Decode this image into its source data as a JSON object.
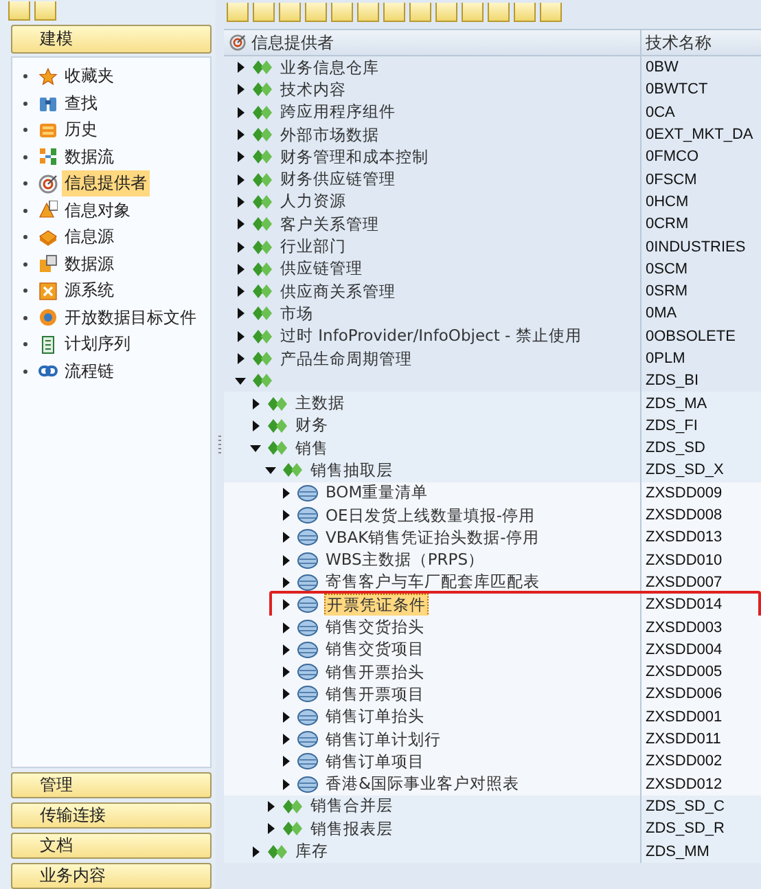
{
  "sidebar": {
    "header": "建模",
    "items": [
      {
        "label": "收藏夹",
        "selected": false
      },
      {
        "label": "查找",
        "selected": false
      },
      {
        "label": "历史",
        "selected": false
      },
      {
        "label": "数据流",
        "selected": false
      },
      {
        "label": "信息提供者",
        "selected": true
      },
      {
        "label": "信息对象",
        "selected": false
      },
      {
        "label": "信息源",
        "selected": false
      },
      {
        "label": "数据源",
        "selected": false
      },
      {
        "label": "源系统",
        "selected": false
      },
      {
        "label": "开放数据目标文件",
        "selected": false
      },
      {
        "label": "计划序列",
        "selected": false
      },
      {
        "label": "流程链",
        "selected": false
      }
    ],
    "sections": [
      "管理",
      "传输连接",
      "文档",
      "业务内容"
    ]
  },
  "tree": {
    "columns": [
      "信息提供者",
      "技术名称"
    ],
    "nodes": [
      {
        "kind": "area",
        "label": "业务信息仓库",
        "tech": "0BW",
        "expanded": false,
        "selected": false
      },
      {
        "kind": "area",
        "label": "技术内容",
        "tech": "0BWTCT",
        "expanded": false,
        "selected": false
      },
      {
        "kind": "area",
        "label": "跨应用程序组件",
        "tech": "0CA",
        "expanded": false,
        "selected": false
      },
      {
        "kind": "area",
        "label": "外部市场数据",
        "tech": "0EXT_MKT_DA",
        "expanded": false,
        "selected": false
      },
      {
        "kind": "area",
        "label": "财务管理和成本控制",
        "tech": "0FMCO",
        "expanded": false,
        "selected": false
      },
      {
        "kind": "area",
        "label": "财务供应链管理",
        "tech": "0FSCM",
        "expanded": false,
        "selected": false
      },
      {
        "kind": "area",
        "label": "人力资源",
        "tech": "0HCM",
        "expanded": false,
        "selected": false
      },
      {
        "kind": "area",
        "label": "客户关系管理",
        "tech": "0CRM",
        "expanded": false,
        "selected": false
      },
      {
        "kind": "area",
        "label": "行业部门",
        "tech": "0INDUSTRIES",
        "expanded": false,
        "selected": false
      },
      {
        "kind": "area",
        "label": "供应链管理",
        "tech": "0SCM",
        "expanded": false,
        "selected": false
      },
      {
        "kind": "area",
        "label": "供应商关系管理",
        "tech": "0SRM",
        "expanded": false,
        "selected": false
      },
      {
        "kind": "area",
        "label": "市场",
        "tech": "0MA",
        "expanded": false,
        "selected": false
      },
      {
        "kind": "area",
        "label": "过时 InfoProvider/InfoObject - 禁止使用",
        "tech": "0OBSOLETE",
        "expanded": false,
        "selected": false
      },
      {
        "kind": "area",
        "label": "产品生命周期管理",
        "tech": "0PLM",
        "expanded": false,
        "selected": false
      },
      {
        "kind": "area",
        "tech": "ZDS_BI",
        "expanded": true,
        "selected": false,
        "children": [
          {
            "kind": "area",
            "label": "主数据",
            "tech": "ZDS_MA",
            "expanded": false,
            "selected": false
          },
          {
            "kind": "area",
            "label": "财务",
            "tech": "ZDS_FI",
            "expanded": false,
            "selected": false
          },
          {
            "kind": "area",
            "label": "销售",
            "tech": "ZDS_SD",
            "expanded": true,
            "selected": false,
            "children": [
              {
                "kind": "area",
                "label": "销售抽取层",
                "tech": "ZDS_SD_X",
                "expanded": true,
                "selected": false,
                "children": [
                  {
                    "kind": "cube",
                    "label": "BOM重量清单",
                    "tech": "ZXSDD009",
                    "expanded": false,
                    "selected": false
                  },
                  {
                    "kind": "cube",
                    "label": "OE日发货上线数量填报-停用",
                    "tech": "ZXSDD008",
                    "expanded": false,
                    "selected": false
                  },
                  {
                    "kind": "cube",
                    "label": "VBAK销售凭证抬头数据-停用",
                    "tech": "ZXSDD013",
                    "expanded": false,
                    "selected": false
                  },
                  {
                    "kind": "cube",
                    "label": "WBS主数据（PRPS）",
                    "tech": "ZXSDD010",
                    "expanded": false,
                    "selected": false
                  },
                  {
                    "kind": "cube",
                    "label": "寄售客户与车厂配套库匹配表",
                    "tech": "ZXSDD007",
                    "expanded": false,
                    "selected": false
                  },
                  {
                    "kind": "cube",
                    "label": "开票凭证条件",
                    "tech": "ZXSDD014",
                    "expanded": false,
                    "selected": true
                  },
                  {
                    "kind": "cube",
                    "label": "销售交货抬头",
                    "tech": "ZXSDD003",
                    "expanded": false,
                    "selected": false
                  },
                  {
                    "kind": "cube",
                    "label": "销售交货项目",
                    "tech": "ZXSDD004",
                    "expanded": false,
                    "selected": false
                  },
                  {
                    "kind": "cube",
                    "label": "销售开票抬头",
                    "tech": "ZXSDD005",
                    "expanded": false,
                    "selected": false
                  },
                  {
                    "kind": "cube",
                    "label": "销售开票项目",
                    "tech": "ZXSDD006",
                    "expanded": false,
                    "selected": false
                  },
                  {
                    "kind": "cube",
                    "label": "销售订单抬头",
                    "tech": "ZXSDD001",
                    "expanded": false,
                    "selected": false
                  },
                  {
                    "kind": "cube",
                    "label": "销售订单计划行",
                    "tech": "ZXSDD011",
                    "expanded": false,
                    "selected": false
                  },
                  {
                    "kind": "cube",
                    "label": "销售订单项目",
                    "tech": "ZXSDD002",
                    "expanded": false,
                    "selected": false
                  },
                  {
                    "kind": "cube",
                    "label": "香港&国际事业客户对照表",
                    "tech": "ZXSDD012",
                    "expanded": false,
                    "selected": false
                  }
                ]
              },
              {
                "kind": "area",
                "label": "销售合并层",
                "tech": "ZDS_SD_C",
                "expanded": false,
                "selected": false
              },
              {
                "kind": "area",
                "label": "销售报表层",
                "tech": "ZDS_SD_R",
                "expanded": false,
                "selected": false
              }
            ]
          },
          {
            "kind": "area",
            "label": "库存",
            "tech": "ZDS_MM",
            "expanded": false,
            "selected": false
          }
        ]
      }
    ]
  }
}
